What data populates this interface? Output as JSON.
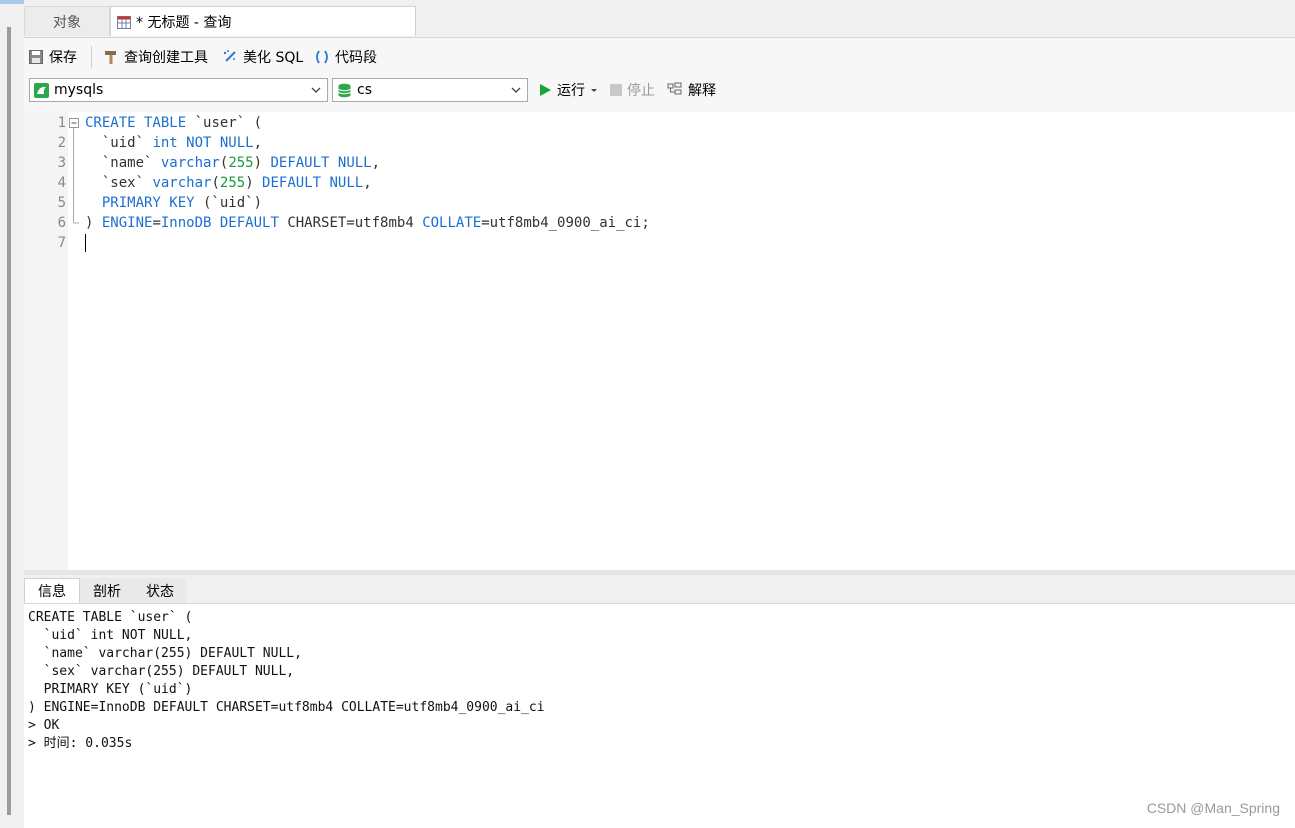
{
  "tabs": {
    "objects": "对象",
    "query": "* 无标题 - 查询"
  },
  "toolbar": {
    "save": "保存",
    "query_builder": "查询创建工具",
    "beautify": "美化 SQL",
    "snippet": "代码段",
    "run": "运行",
    "stop": "停止",
    "explain": "解释"
  },
  "connection": {
    "value": "mysqls",
    "icon": "mysql-connection-icon",
    "icon_color": "#2aa84a"
  },
  "database": {
    "value": "cs",
    "icon": "database-icon",
    "icon_color": "#2aa84a"
  },
  "editor": {
    "line_numbers": [
      "1",
      "2",
      "3",
      "4",
      "5",
      "6",
      "7"
    ],
    "lines": [
      [
        {
          "t": "CREATE TABLE",
          "k": "kw"
        },
        {
          "t": " `user` (",
          "k": "tx"
        }
      ],
      [
        {
          "t": "  `uid` ",
          "k": "tx"
        },
        {
          "t": "int NOT NULL",
          "k": "kw"
        },
        {
          "t": ",",
          "k": "tx"
        }
      ],
      [
        {
          "t": "  `name` ",
          "k": "tx"
        },
        {
          "t": "varchar",
          "k": "kw"
        },
        {
          "t": "(",
          "k": "tx"
        },
        {
          "t": "255",
          "k": "num"
        },
        {
          "t": ") ",
          "k": "tx"
        },
        {
          "t": "DEFAULT NULL",
          "k": "kw"
        },
        {
          "t": ",",
          "k": "tx"
        }
      ],
      [
        {
          "t": "  `sex` ",
          "k": "tx"
        },
        {
          "t": "varchar",
          "k": "kw"
        },
        {
          "t": "(",
          "k": "tx"
        },
        {
          "t": "255",
          "k": "num"
        },
        {
          "t": ") ",
          "k": "tx"
        },
        {
          "t": "DEFAULT NULL",
          "k": "kw"
        },
        {
          "t": ",",
          "k": "tx"
        }
      ],
      [
        {
          "t": "  ",
          "k": "tx"
        },
        {
          "t": "PRIMARY KEY",
          "k": "kw"
        },
        {
          "t": " (`uid`)",
          "k": "tx"
        }
      ],
      [
        {
          "t": ") ",
          "k": "tx"
        },
        {
          "t": "ENGINE",
          "k": "kw"
        },
        {
          "t": "=",
          "k": "tx"
        },
        {
          "t": "InnoDB DEFAULT",
          "k": "kw"
        },
        {
          "t": " CHARSET=utf8mb4 ",
          "k": "tx"
        },
        {
          "t": "COLLATE",
          "k": "kw"
        },
        {
          "t": "=utf8mb4_0900_ai_ci;",
          "k": "tx"
        }
      ],
      []
    ],
    "keyword_color": "#1c6fd0",
    "number_color": "#1a9a3c"
  },
  "result_tabs": {
    "info": "信息",
    "profile": "剖析",
    "status": "状态"
  },
  "output_lines": [
    "CREATE TABLE `user` (",
    "  `uid` int NOT NULL,",
    "  `name` varchar(255) DEFAULT NULL,",
    "  `sex` varchar(255) DEFAULT NULL,",
    "  PRIMARY KEY (`uid`)",
    ") ENGINE=InnoDB DEFAULT CHARSET=utf8mb4 COLLATE=utf8mb4_0900_ai_ci",
    "> OK",
    "> 时间: 0.035s"
  ],
  "watermark": "CSDN @Man_Spring"
}
